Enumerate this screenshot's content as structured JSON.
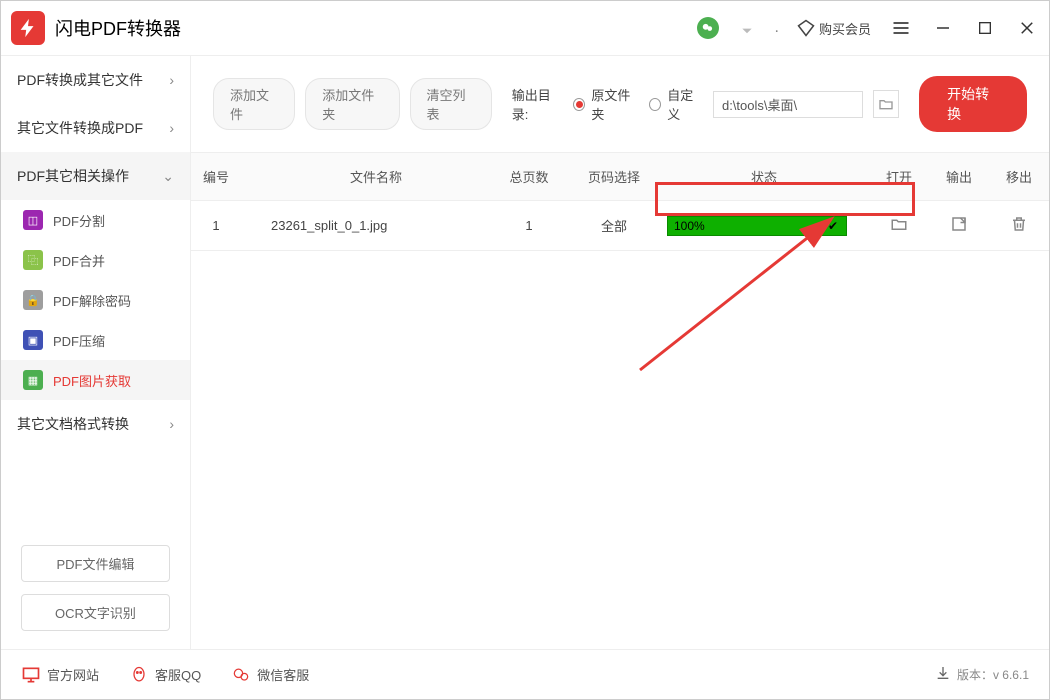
{
  "app": {
    "title": "闪电PDF转换器"
  },
  "titlebar": {
    "vip_label": "购买会员"
  },
  "sidebar": {
    "groups": [
      {
        "label": "PDF转换成其它文件"
      },
      {
        "label": "其它文件转换成PDF"
      },
      {
        "label": "PDF其它相关操作"
      },
      {
        "label": "其它文档格式转换"
      }
    ],
    "subitems": [
      {
        "label": "PDF分割"
      },
      {
        "label": "PDF合并"
      },
      {
        "label": "PDF解除密码"
      },
      {
        "label": "PDF压缩"
      },
      {
        "label": "PDF图片获取"
      }
    ],
    "buttons": {
      "edit": "PDF文件编辑",
      "ocr": "OCR文字识别"
    }
  },
  "toolbar": {
    "add_file": "添加文件",
    "add_folder": "添加文件夹",
    "clear": "清空列表",
    "output_label": "输出目录:",
    "radio_original": "原文件夹",
    "radio_custom": "自定义",
    "path": "d:\\tools\\桌面\\",
    "start": "开始转换"
  },
  "table": {
    "headers": {
      "id": "编号",
      "name": "文件名称",
      "pages": "总页数",
      "pagesel": "页码选择",
      "status": "状态",
      "open": "打开",
      "out": "输出",
      "del": "移出"
    },
    "rows": [
      {
        "id": "1",
        "name": "23261_split_0_1.jpg",
        "pages": "1",
        "pagesel": "全部",
        "progress": "100%"
      }
    ]
  },
  "footer": {
    "links": {
      "site": "官方网站",
      "qq": "客服QQ",
      "wechat": "微信客服"
    },
    "version": "版本：v 6.6.1"
  }
}
